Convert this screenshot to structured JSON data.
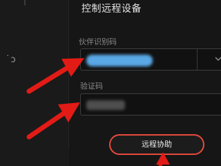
{
  "dialog": {
    "title": "控制远程设备",
    "partner_id_label": "伙伴识别码",
    "partner_id_value": "",
    "verification_code_label": "验证码",
    "verification_code_value": "",
    "connect_button_label": "远程协助"
  },
  "sidebar": {
    "refresh_icon": "refresh-icon"
  },
  "annotations": {
    "arrow_color": "#e21b16",
    "arrows": [
      "arrow-to-partner-id",
      "arrow-to-verification-code",
      "arrow-to-remote-assist-button"
    ]
  },
  "colors": {
    "background": "#161616",
    "accent": "#e84a3c",
    "redacted_blue": "#5aa9e6"
  }
}
